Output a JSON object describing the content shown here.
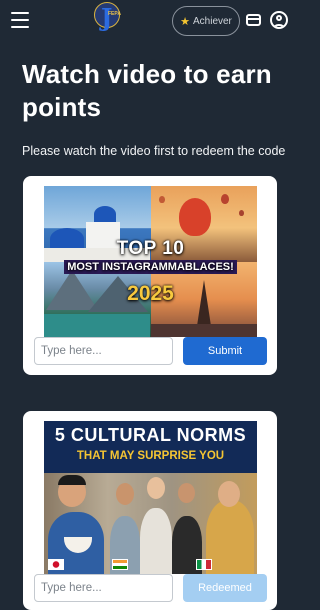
{
  "header": {
    "logo_text": "FEPA",
    "achiever_label": "Achiever",
    "icons": [
      "menu-icon",
      "star-icon",
      "wallet-icon",
      "user-icon"
    ],
    "colors": {
      "background": "#1f2935",
      "accent": "#1f6ad1",
      "badge_star": "#f4c531"
    }
  },
  "page": {
    "title": "Watch video to earn points",
    "subtitle": "Please watch the video first to redeem the code"
  },
  "cards": [
    {
      "thumbnail": {
        "line1": "TOP 10",
        "line2": "MOST INSTAGRAMMABLACES!",
        "line3": "2025"
      },
      "input_placeholder": "Type here...",
      "button_label": "Submit",
      "button_state": "active"
    },
    {
      "thumbnail": {
        "line1": "5 CULTURAL NORMS",
        "line2": "THAT MAY SURPRISE YOU"
      },
      "input_placeholder": "Type here...",
      "button_label": "Redeemed",
      "button_state": "disabled"
    }
  ]
}
